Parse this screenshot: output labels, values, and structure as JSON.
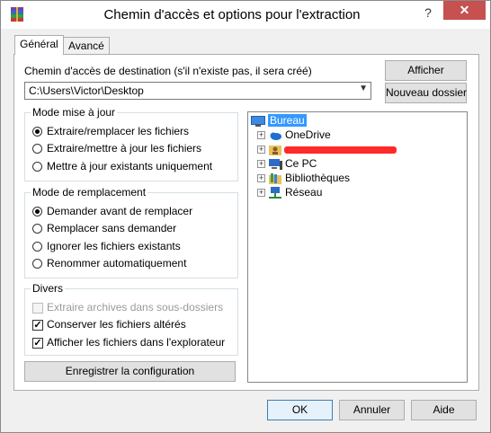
{
  "window": {
    "title": "Chemin d'accès et options pour l'extraction",
    "help": "?",
    "close": "✕"
  },
  "tabs": [
    {
      "label": "Général",
      "active": true
    },
    {
      "label": "Avancé",
      "active": false
    }
  ],
  "destination": {
    "label": "Chemin d'accès de destination (s'il n'existe pas, il sera créé)",
    "value": "C:\\Users\\Victor\\Desktop",
    "show_button": "Afficher",
    "new_folder_button": "Nouveau dossier"
  },
  "update_mode": {
    "title": "Mode mise à jour",
    "options": [
      {
        "label": "Extraire/remplacer les fichiers",
        "selected": true
      },
      {
        "label": "Extraire/mettre à jour les fichiers",
        "selected": false
      },
      {
        "label": "Mettre à jour existants uniquement",
        "selected": false
      }
    ]
  },
  "overwrite_mode": {
    "title": "Mode de remplacement",
    "options": [
      {
        "label": "Demander avant de remplacer",
        "selected": true
      },
      {
        "label": "Remplacer sans demander",
        "selected": false
      },
      {
        "label": "Ignorer les fichiers existants",
        "selected": false
      },
      {
        "label": "Renommer automatiquement",
        "selected": false
      }
    ]
  },
  "misc": {
    "title": "Divers",
    "options": [
      {
        "label": "Extraire archives dans sous-dossiers",
        "checked": false,
        "disabled": true
      },
      {
        "label": "Conserver les fichiers altérés",
        "checked": true,
        "disabled": false
      },
      {
        "label": "Afficher les fichiers dans l'explorateur",
        "checked": true,
        "disabled": false
      }
    ]
  },
  "save_config_button": "Enregistrer la configuration",
  "tree": {
    "items": [
      {
        "label": "Bureau",
        "icon": "desktop-icon",
        "selected": true
      },
      {
        "label": "OneDrive",
        "icon": "cloud-icon",
        "selected": false
      },
      {
        "label": "",
        "icon": "user-folder-icon",
        "selected": false,
        "redacted": true
      },
      {
        "label": "Ce PC",
        "icon": "computer-icon",
        "selected": false
      },
      {
        "label": "Bibliothèques",
        "icon": "library-icon",
        "selected": false
      },
      {
        "label": "Réseau",
        "icon": "network-icon",
        "selected": false
      }
    ]
  },
  "footer": {
    "ok": "OK",
    "cancel": "Annuler",
    "help": "Aide"
  },
  "colors": {
    "accent": "#3399ff",
    "close_button": "#c75050",
    "redaction": "#ff2a2a"
  }
}
